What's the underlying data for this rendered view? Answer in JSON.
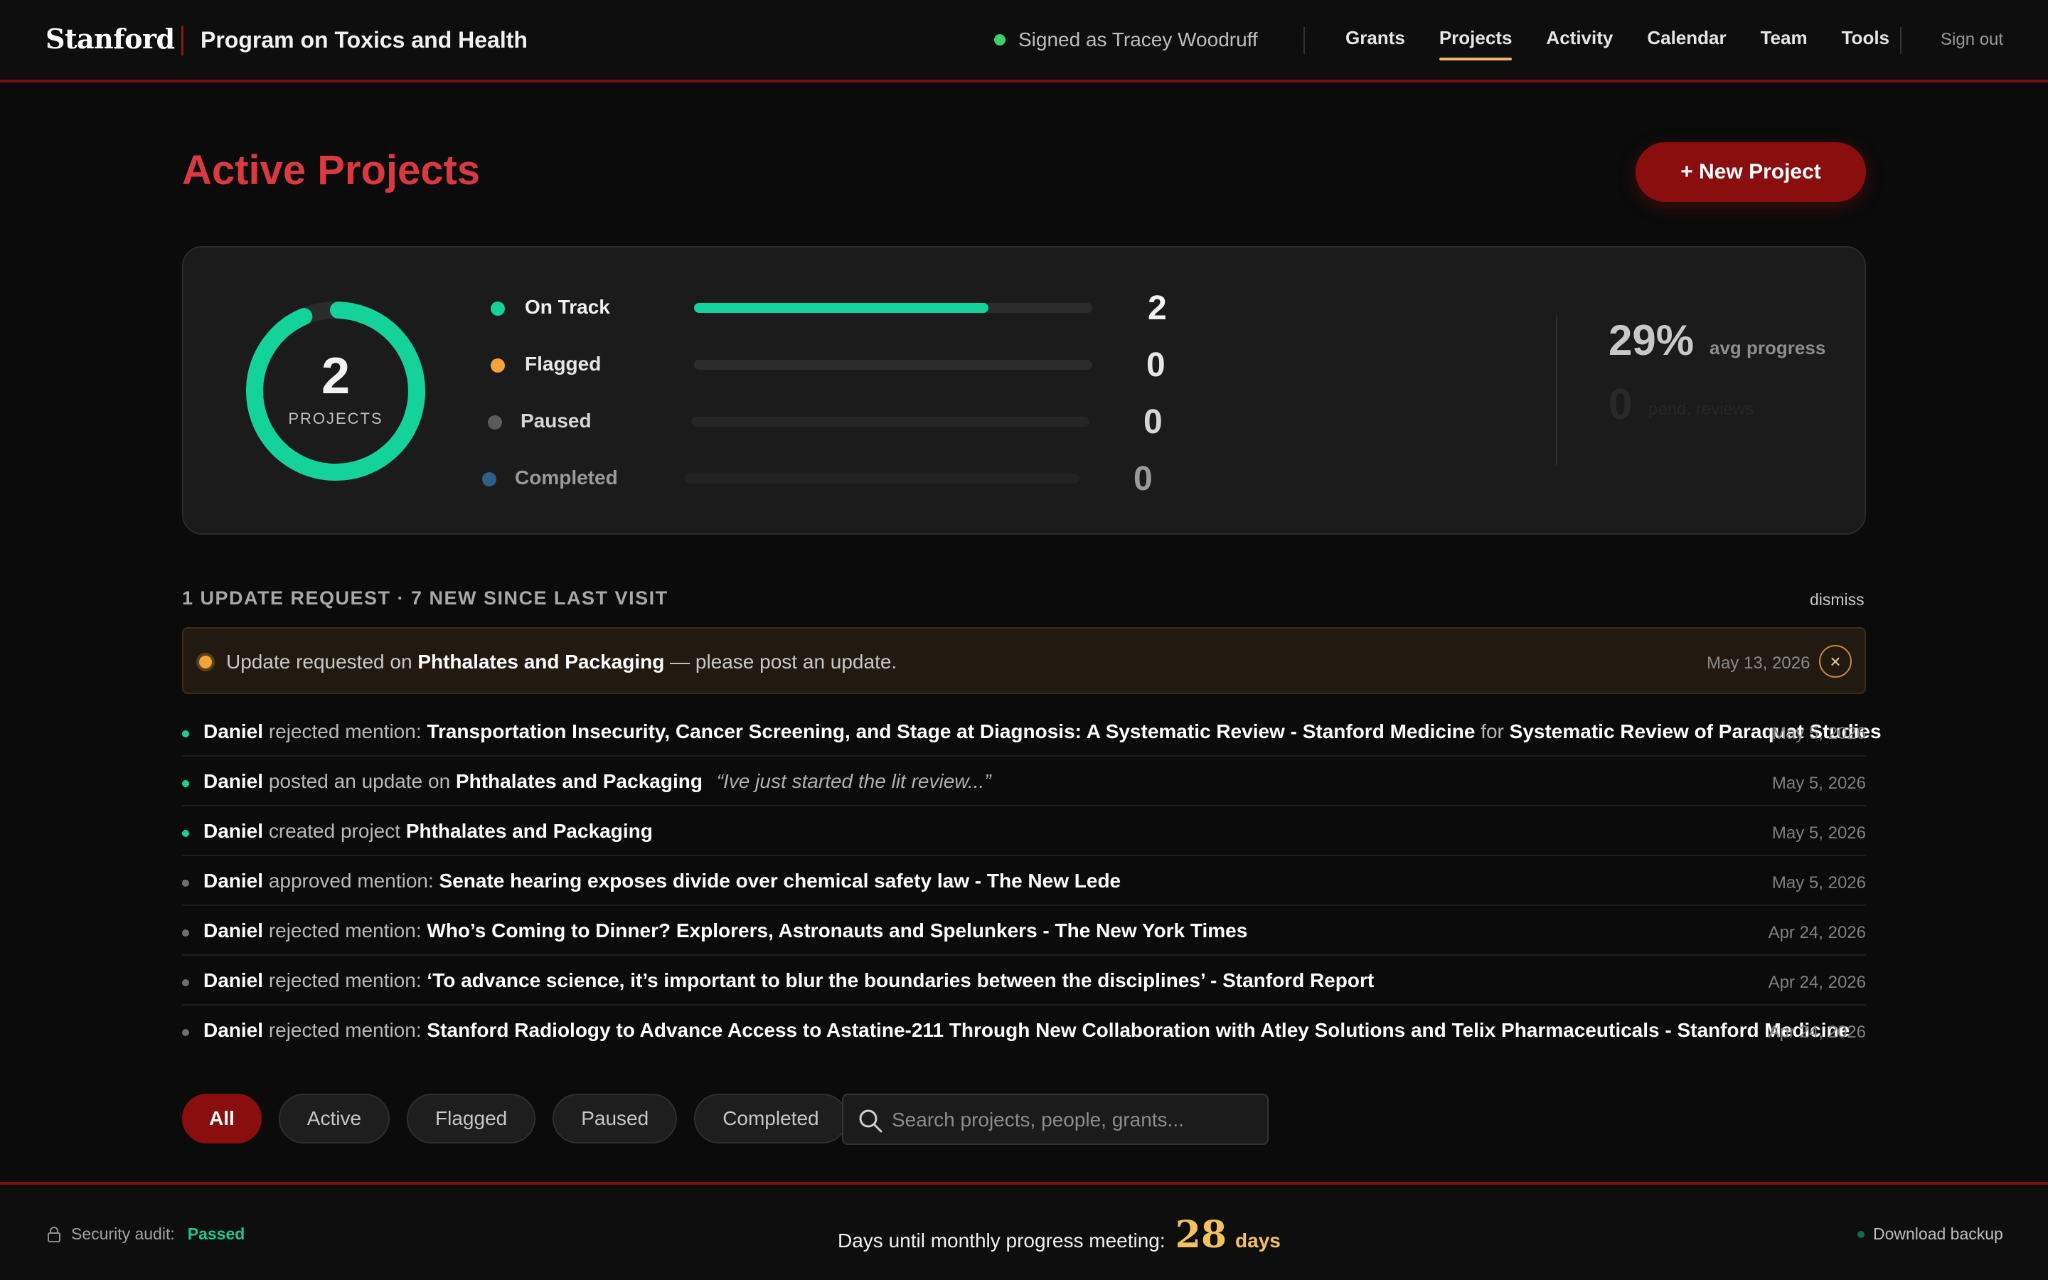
{
  "header": {
    "logo": "Stanford",
    "program": "Program on Toxics and Health",
    "signed_in": "Signed as Tracey Woodruff",
    "nav": [
      {
        "label": "Grants",
        "active": false
      },
      {
        "label": "Projects",
        "active": true
      },
      {
        "label": "Activity",
        "active": false
      },
      {
        "label": "Calendar",
        "active": false
      },
      {
        "label": "Team",
        "active": false
      },
      {
        "label": "Tools",
        "active": false
      }
    ],
    "sign_out": "Sign out"
  },
  "page": {
    "title": "Active Projects",
    "new_project_label": "+ New Project"
  },
  "summary": {
    "total": "2",
    "total_label": "PROJECTS",
    "statuses": [
      {
        "label": "On Track",
        "count": "2",
        "fraction": 0.74,
        "color": "#14d39a"
      },
      {
        "label": "Flagged",
        "count": "0",
        "fraction": 0,
        "color": "#f2a33a"
      },
      {
        "label": "Paused",
        "count": "0",
        "fraction": 0,
        "color": "#5b5b5b"
      },
      {
        "label": "Completed",
        "count": "0",
        "fraction": 0,
        "color": "#2f5f88"
      }
    ],
    "avg_progress": "29%",
    "avg_progress_label": "avg progress",
    "secondary_value": "0",
    "secondary_label": "pend. reviews"
  },
  "updates": {
    "header": "1 UPDATE REQUEST · 7 NEW SINCE LAST VISIT",
    "dismiss": "dismiss",
    "request": {
      "prefix": "Update requested on",
      "project": "Phthalates and Packaging",
      "suffix": "— please post an update.",
      "date": "May 13, 2026",
      "close_icon": "×"
    },
    "activity": [
      {
        "actor": "Daniel",
        "action": "rejected mention:",
        "target": "Transportation Insecurity, Cancer Screening, and Stage at Diagnosis: A Systematic Review - Stanford Medicine",
        "connector": "for",
        "project": "Systematic Review of Paraquat Studies",
        "quote": "",
        "date": "May 5, 2026",
        "is_new": true
      },
      {
        "actor": "Daniel",
        "action": "posted an update on",
        "target": "Phthalates and Packaging",
        "connector": "",
        "project": "",
        "quote": "“Ive just started the lit review...”",
        "date": "May 5, 2026",
        "is_new": true
      },
      {
        "actor": "Daniel",
        "action": "created project",
        "target": "Phthalates and Packaging",
        "connector": "",
        "project": "",
        "quote": "",
        "date": "May 5, 2026",
        "is_new": true
      },
      {
        "actor": "Daniel",
        "action": "approved mention:",
        "target": "Senate hearing exposes divide over chemical safety law - The New Lede",
        "connector": "",
        "project": "",
        "quote": "",
        "date": "May 5, 2026",
        "is_new": false
      },
      {
        "actor": "Daniel",
        "action": "rejected mention:",
        "target": "Who’s Coming to Dinner? Explorers, Astronauts and Spelunkers - The New York Times",
        "connector": "",
        "project": "",
        "quote": "",
        "date": "Apr 24, 2026",
        "is_new": false
      },
      {
        "actor": "Daniel",
        "action": "rejected mention:",
        "target": "‘To advance science, it’s important to blur the boundaries between the disciplines’ - Stanford Report",
        "connector": "",
        "project": "",
        "quote": "",
        "date": "Apr 24, 2026",
        "is_new": false
      },
      {
        "actor": "Daniel",
        "action": "rejected mention:",
        "target": "Stanford Radiology to Advance Access to Astatine-211 Through New Collaboration with Atley Solutions and Telix Pharmaceuticals - Stanford Medicine",
        "connector": "",
        "project": "",
        "quote": "",
        "date": "Apr 24, 2026",
        "is_new": false
      }
    ]
  },
  "filters": {
    "chips": [
      {
        "label": "All",
        "active": true
      },
      {
        "label": "Active",
        "active": false
      },
      {
        "label": "Flagged",
        "active": false
      },
      {
        "label": "Paused",
        "active": false
      },
      {
        "label": "Completed",
        "active": false
      }
    ],
    "search_placeholder": "Search projects, people, grants..."
  },
  "footer": {
    "audit_label": "Security audit:",
    "audit_status": "Passed",
    "countdown_text": "Days until monthly progress meeting:",
    "countdown_value": "28",
    "countdown_unit": "days",
    "backup": "Download backup"
  },
  "colors": {
    "accent": "#8a0e0e",
    "title_red": "#d9393f",
    "on_track": "#14d39a",
    "flagged": "#f2a33a",
    "new_dot": "#14d39a",
    "old_dot": "#6f6f6f"
  }
}
